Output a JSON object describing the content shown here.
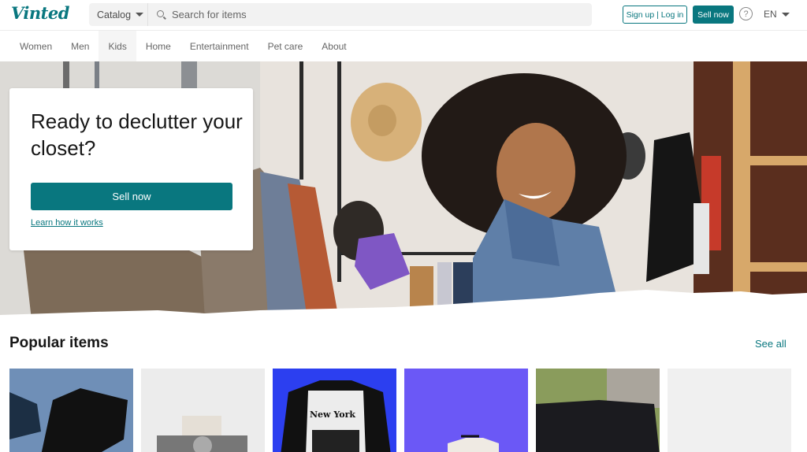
{
  "header": {
    "logo": "Vinted",
    "catalog_label": "Catalog",
    "search_placeholder": "Search for items",
    "signup_login_label": "Sign up | Log in",
    "sell_now_label": "Sell now",
    "help_icon": "?",
    "language": "EN"
  },
  "nav": {
    "items": [
      {
        "label": "Women"
      },
      {
        "label": "Men"
      },
      {
        "label": "Kids",
        "active": true
      },
      {
        "label": "Home"
      },
      {
        "label": "Entertainment"
      },
      {
        "label": "Pet care"
      },
      {
        "label": "About"
      }
    ]
  },
  "hero": {
    "title": "Ready to declutter your closet?",
    "sell_button": "Sell now",
    "learn_link": "Learn how it works"
  },
  "popular": {
    "title": "Popular items",
    "see_all": "See all",
    "items": [
      {
        "description": "black trousers on blue carpet"
      },
      {
        "description": "skull bracelet on white candle"
      },
      {
        "description": "New York raglan t-shirt on blue background",
        "print_text": "New York"
      },
      {
        "description": "white t-shirt on hanger, purple background"
      },
      {
        "description": "black skirt on patterned blanket"
      },
      {
        "description": "loading placeholder"
      }
    ]
  },
  "colors": {
    "brand": "#09777f"
  }
}
